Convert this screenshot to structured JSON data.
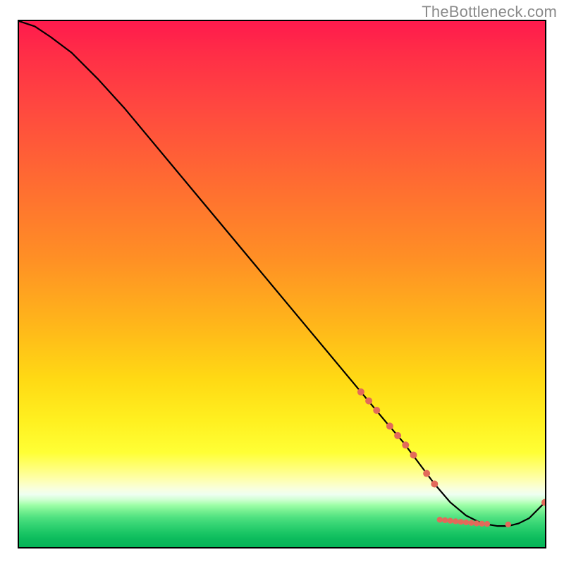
{
  "attribution": "TheBottleneck.com",
  "chart_data": {
    "type": "line",
    "title": "",
    "xlabel": "",
    "ylabel": "",
    "xlim": [
      0,
      100
    ],
    "ylim": [
      0,
      100
    ],
    "background_gradient": {
      "direction": "vertical",
      "stops": [
        {
          "pos": 0.0,
          "color": "#ff1a4d"
        },
        {
          "pos": 0.3,
          "color": "#ff6a32"
        },
        {
          "pos": 0.58,
          "color": "#ffb71a"
        },
        {
          "pos": 0.82,
          "color": "#ffff35"
        },
        {
          "pos": 0.9,
          "color": "#eefff1"
        },
        {
          "pos": 1.0,
          "color": "#05b557"
        }
      ]
    },
    "series": [
      {
        "name": "bottleneck-curve",
        "x": [
          0,
          3,
          6,
          10,
          15,
          20,
          25,
          30,
          35,
          40,
          45,
          50,
          55,
          60,
          65,
          70,
          73,
          76,
          79,
          82,
          85,
          88,
          91,
          93,
          95,
          97,
          100
        ],
        "y": [
          100,
          99,
          97,
          94,
          89,
          83.5,
          77.5,
          71.5,
          65.5,
          59.5,
          53.5,
          47.5,
          41.5,
          35.5,
          29.5,
          23.5,
          20,
          16,
          12,
          8.5,
          6,
          4.5,
          4,
          4,
          4.5,
          5.5,
          8.5
        ],
        "color": "#000000",
        "stroke_width": 2.2
      }
    ],
    "markers": [
      {
        "x": 65.0,
        "y": 29.5,
        "r": 5
      },
      {
        "x": 66.5,
        "y": 27.8,
        "r": 5
      },
      {
        "x": 68.0,
        "y": 26.0,
        "r": 5
      },
      {
        "x": 70.5,
        "y": 23.0,
        "r": 5
      },
      {
        "x": 72.0,
        "y": 21.2,
        "r": 5
      },
      {
        "x": 73.5,
        "y": 19.4,
        "r": 5
      },
      {
        "x": 75.0,
        "y": 17.5,
        "r": 5
      },
      {
        "x": 77.5,
        "y": 14.0,
        "r": 5
      },
      {
        "x": 79.0,
        "y": 12.0,
        "r": 5
      },
      {
        "x": 80.0,
        "y": 5.2,
        "r": 4.2
      },
      {
        "x": 81.0,
        "y": 5.1,
        "r": 4.2
      },
      {
        "x": 82.0,
        "y": 5.0,
        "r": 4.2
      },
      {
        "x": 83.0,
        "y": 4.9,
        "r": 4.2
      },
      {
        "x": 84.0,
        "y": 4.8,
        "r": 4.2
      },
      {
        "x": 85.0,
        "y": 4.7,
        "r": 4.2
      },
      {
        "x": 86.0,
        "y": 4.6,
        "r": 4.2
      },
      {
        "x": 87.0,
        "y": 4.5,
        "r": 4.2
      },
      {
        "x": 88.0,
        "y": 4.45,
        "r": 4.2
      },
      {
        "x": 89.0,
        "y": 4.4,
        "r": 4.2
      },
      {
        "x": 93.0,
        "y": 4.3,
        "r": 4.2
      },
      {
        "x": 100.0,
        "y": 8.5,
        "r": 5
      }
    ],
    "marker_color": "#e26a5a"
  }
}
